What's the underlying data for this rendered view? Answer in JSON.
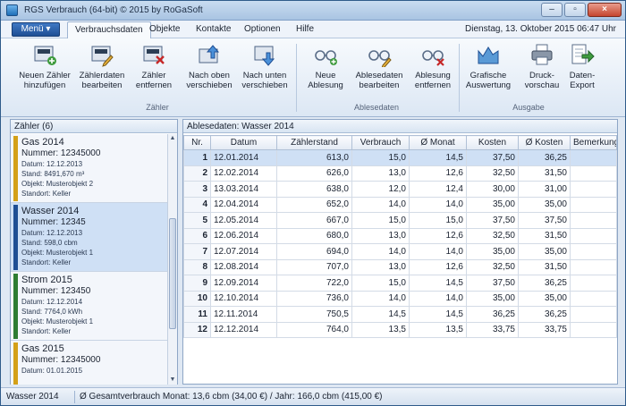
{
  "window": {
    "title": "RGS Verbrauch (64-bit) © 2015 by RoGaSoft",
    "minimize": "–",
    "maximize": "▫",
    "close": "×"
  },
  "menubar": {
    "menu_button": "Menü ▾",
    "tabs": [
      "Verbrauchsdaten",
      "Objekte",
      "Kontakte",
      "Optionen",
      "Hilfe"
    ],
    "datetime": "Dienstag, 13. Oktober 2015  06:47 Uhr"
  },
  "ribbon": {
    "groups": [
      {
        "label": "Zähler",
        "buttons": [
          "Neuen Zähler|hinzufügen",
          "Zählerdaten|bearbeiten",
          "Zähler|entfernen",
          "Nach oben|verschieben",
          "Nach unten|verschieben"
        ]
      },
      {
        "label": "Ablesedaten",
        "buttons": [
          "Neue|Ablesung",
          "Ablesedaten|bearbeiten",
          "Ablesung|entfernen"
        ]
      },
      {
        "label": "Ausgabe",
        "buttons": [
          "Grafische|Auswertung",
          "Druck-|vorschau",
          "Daten-|Export"
        ]
      }
    ]
  },
  "left_panel": {
    "header": "Zähler (6)",
    "cards": [
      {
        "name": "Gas 2014",
        "number": "Nummer: 12345000",
        "datum": "Datum: 12.12.2013",
        "stand": "Stand: 8491,670 m³",
        "objekt": "Objekt: Musterobjekt 2",
        "standort": "Standort: Keller",
        "color": "#d4a017"
      },
      {
        "name": "Wasser 2014",
        "number": "Nummer: 12345",
        "datum": "Datum: 12.12.2013",
        "stand": "Stand: 598,0 cbm",
        "objekt": "Objekt: Musterobjekt 1",
        "standort": "Standort: Keller",
        "color": "#1f4f94"
      },
      {
        "name": "Strom 2015",
        "number": "Nummer: 123450",
        "datum": "Datum: 12.12.2014",
        "stand": "Stand: 7764,0 kWh",
        "objekt": "Objekt: Musterobjekt 1",
        "standort": "Standort: Keller",
        "color": "#2e7d32"
      },
      {
        "name": "Gas 2015",
        "number": "Nummer: 12345000",
        "datum": "Datum: 01.01.2015",
        "stand": "",
        "objekt": "",
        "standort": "",
        "color": "#d4a017"
      }
    ]
  },
  "right_panel": {
    "header": "Ablesedaten: Wasser 2014",
    "columns": [
      "Nr.",
      "Datum",
      "Zählerstand",
      "Verbrauch",
      "Ø Monat",
      "Kosten",
      "Ø Kosten",
      "Bemerkung"
    ],
    "rows": [
      [
        "1",
        "12.01.2014",
        "613,0",
        "15,0",
        "14,5",
        "37,50",
        "36,25",
        ""
      ],
      [
        "2",
        "12.02.2014",
        "626,0",
        "13,0",
        "12,6",
        "32,50",
        "31,50",
        ""
      ],
      [
        "3",
        "13.03.2014",
        "638,0",
        "12,0",
        "12,4",
        "30,00",
        "31,00",
        ""
      ],
      [
        "4",
        "12.04.2014",
        "652,0",
        "14,0",
        "14,0",
        "35,00",
        "35,00",
        ""
      ],
      [
        "5",
        "12.05.2014",
        "667,0",
        "15,0",
        "15,0",
        "37,50",
        "37,50",
        ""
      ],
      [
        "6",
        "12.06.2014",
        "680,0",
        "13,0",
        "12,6",
        "32,50",
        "31,50",
        ""
      ],
      [
        "7",
        "12.07.2014",
        "694,0",
        "14,0",
        "14,0",
        "35,00",
        "35,00",
        ""
      ],
      [
        "8",
        "12.08.2014",
        "707,0",
        "13,0",
        "12,6",
        "32,50",
        "31,50",
        ""
      ],
      [
        "9",
        "12.09.2014",
        "722,0",
        "15,0",
        "14,5",
        "37,50",
        "36,25",
        ""
      ],
      [
        "10",
        "12.10.2014",
        "736,0",
        "14,0",
        "14,0",
        "35,00",
        "35,00",
        ""
      ],
      [
        "11",
        "12.11.2014",
        "750,5",
        "14,5",
        "14,5",
        "36,25",
        "36,25",
        ""
      ],
      [
        "12",
        "12.12.2014",
        "764,0",
        "13,5",
        "13,5",
        "33,75",
        "33,75",
        ""
      ]
    ]
  },
  "status": {
    "meter": "Wasser 2014",
    "summary": "Ø Gesamtverbrauch  Monat: 13,6 cbm  (34,00 €)  /  Jahr: 166,0 cbm  (415,00 €)"
  },
  "colors": {
    "accent": "#1f4f94",
    "selection": "#cfe0f5",
    "gas": "#d4a017",
    "wasser": "#1f4f94",
    "strom": "#2e7d32"
  }
}
